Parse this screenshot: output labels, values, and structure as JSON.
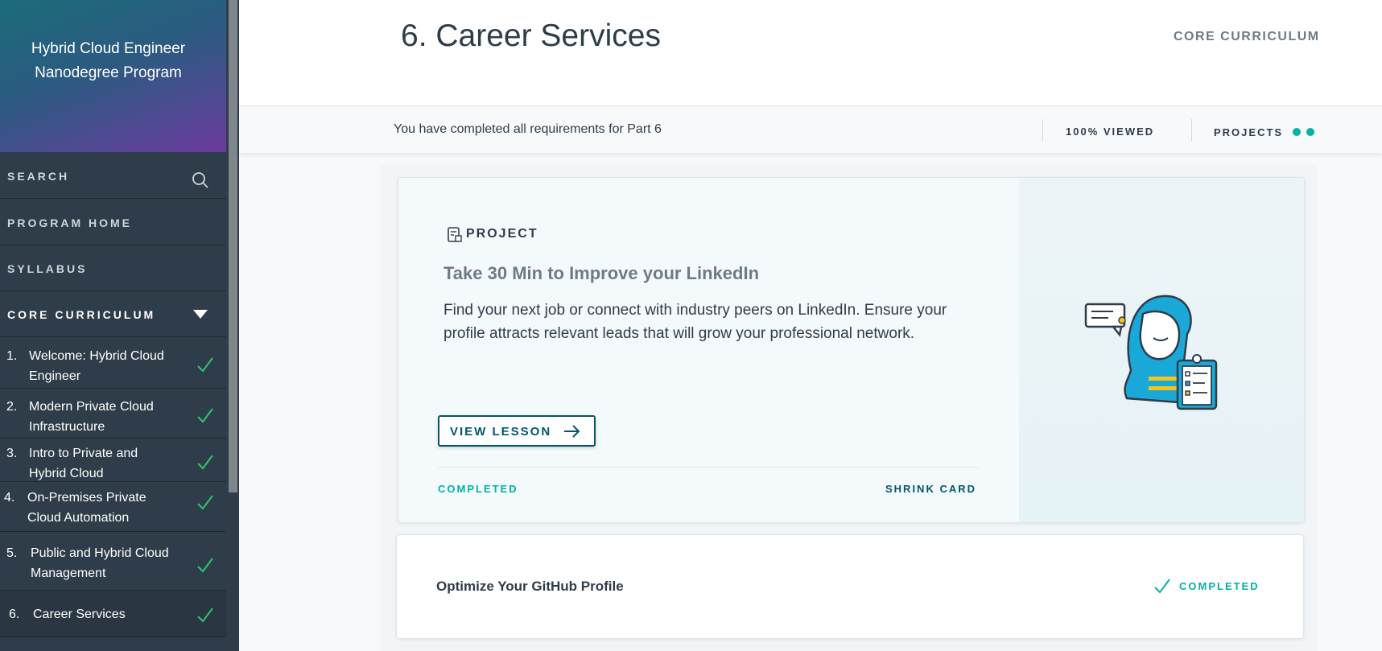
{
  "sidebar": {
    "program_title_line1": "Hybrid Cloud Engineer",
    "program_title_line2": "Nanodegree Program",
    "search_label": "SEARCH",
    "program_home_label": "PROGRAM HOME",
    "syllabus_label": "SYLLABUS",
    "core_label": "CORE CURRICULUM",
    "lessons": [
      {
        "num": "1.",
        "line1": "Welcome: Hybrid Cloud",
        "line2": "Engineer"
      },
      {
        "num": "2.",
        "line1": "Modern Private Cloud",
        "line2": "Infrastructure"
      },
      {
        "num": "3.",
        "line1": "Intro to Private and",
        "line2": "Hybrid Cloud"
      },
      {
        "num": "4.",
        "line1": "On-Premises Private",
        "line2": "Cloud Automation"
      },
      {
        "num": "5.",
        "line1": "Public and Hybrid Cloud",
        "line2": "Management"
      },
      {
        "num": "6.",
        "line1": "Career Services",
        "line2": ""
      }
    ]
  },
  "header": {
    "title": "6. Career Services",
    "section": "CORE CURRICULUM"
  },
  "status": {
    "message": "You have completed all requirements for Part 6",
    "viewed": "100% VIEWED",
    "projects": "PROJECTS"
  },
  "project_card": {
    "type_label": "PROJECT",
    "title": "Take 30 Min to Improve your LinkedIn",
    "description": "Find your next job or connect with industry peers on LinkedIn. Ensure your profile attracts relevant leads that will grow your professional network.",
    "button_label": "VIEW LESSON",
    "status_label": "COMPLETED",
    "shrink_label": "SHRINK CARD"
  },
  "second_card": {
    "title": "Optimize Your GitHub Profile",
    "status": "COMPLETED"
  },
  "colors": {
    "sidebar_bg": "#2e3d49",
    "accent_teal": "#02b3a3",
    "button_blue": "#02566e",
    "check_green": "#34c46e"
  },
  "icons": {
    "search": "search-icon",
    "chevron": "chevron-down-icon",
    "check": "check-icon",
    "project": "project-icon",
    "arrow": "arrow-right-icon"
  }
}
